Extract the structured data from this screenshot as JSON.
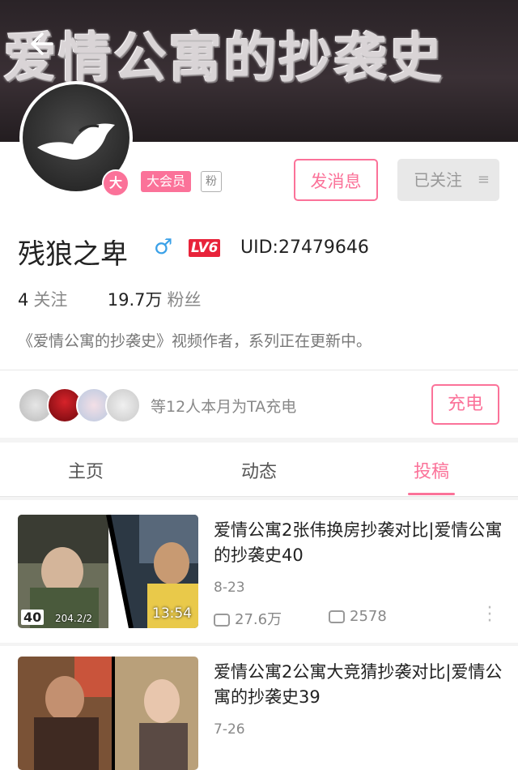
{
  "banner": {
    "text": "爱情公寓的抄袭史"
  },
  "profile": {
    "vip_dot": "大",
    "vip_tag": "大会员",
    "fan_tag": "粉",
    "message_button": "发消息",
    "follow_button": "已关注",
    "name": "残狼之卑",
    "gender": "♂",
    "level": "LV6",
    "uid": "UID:27479646",
    "following_count": "4",
    "following_label": "关注",
    "followers_count": "19.7万",
    "followers_label": "粉丝",
    "bio": "《爱情公寓的抄袭史》视频作者，系列正在更新中。"
  },
  "charge": {
    "text": "等12人本月为TA充电",
    "button": "充电"
  },
  "tabs": [
    {
      "label": "主页"
    },
    {
      "label": "动态"
    },
    {
      "label": "投稿",
      "active": true
    }
  ],
  "videos": [
    {
      "title": "爱情公寓2张伟换房抄袭对比|爱情公寓的抄袭史40",
      "date": "8-23",
      "plays": "27.6万",
      "danmaku": "2578",
      "duration": "13:54",
      "episode": "40",
      "res": "204.2/2"
    },
    {
      "title": "爱情公寓2公寓大竞猜抄袭对比|爱情公寓的抄袭史39",
      "date": "7-26"
    }
  ],
  "colors": {
    "accent": "#fb7299",
    "level": "#e8233a",
    "gender": "#3aa1e8"
  }
}
